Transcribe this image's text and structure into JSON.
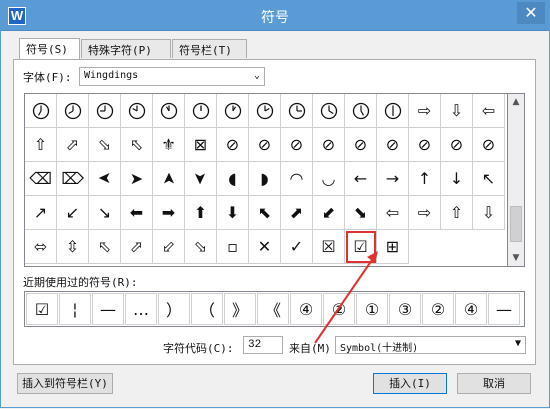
{
  "window": {
    "title": "符号",
    "app_icon": "W",
    "close_icon": "close-icon"
  },
  "tabs": [
    {
      "label": "符号(S)",
      "active": true
    },
    {
      "label": "特殊字符(P)",
      "active": false
    },
    {
      "label": "符号栏(T)",
      "active": false
    }
  ],
  "font": {
    "label": "字体(F):",
    "value": "Wingdings"
  },
  "grid": {
    "rows": [
      [
        "clock-7",
        "clock-8",
        "clock-9",
        "clock-10",
        "clock-11",
        "clock-12",
        "clock-1",
        "clock-2",
        "clock-3",
        "clock-4",
        "clock-5",
        "clock-6",
        "arrow-tab-1",
        "arrow-tab-2",
        "arrow-tab-3"
      ],
      [
        "arrow-tab-4",
        "arrow-tab-5",
        "arrow-tab-6",
        "arrow-tab-7",
        "bow-1",
        "box-x",
        "hook-1",
        "hook-2",
        "hook-3",
        "hook-4",
        "hook-5",
        "hook-6",
        "hook-7",
        "hook-8",
        "hook-9"
      ],
      [
        "backspace-1",
        "backspace-2",
        "arrowhead-left",
        "arrowhead-right",
        "arrowhead-up",
        "arrowhead-down",
        "half-circle-left",
        "half-circle-right",
        "half-circle-up",
        "half-circle-down",
        "arrow-left",
        "arrow-right",
        "arrow-up",
        "arrow-down",
        "arrow-nw"
      ],
      [
        "arrow-ne",
        "arrow-sw",
        "arrow-se",
        "bold-left",
        "bold-right",
        "bold-up",
        "bold-down",
        "bold-nw",
        "bold-ne",
        "bold-sw",
        "bold-se",
        "hollow-left",
        "hollow-right",
        "hollow-up",
        "hollow-down"
      ],
      [
        "hollow-lr",
        "hollow-ud",
        "hollow-nw",
        "hollow-ne",
        "hollow-sw",
        "hollow-se",
        "small-square",
        "x-mark",
        "check-mark",
        "boxed-x",
        "boxed-check",
        "windows-logo"
      ]
    ],
    "selected": "boxed-check"
  },
  "recent": {
    "label": "近期使用过的符号(R):",
    "items": [
      "☑",
      "¦",
      "—",
      "…",
      "）",
      "（",
      "》",
      "《",
      "④",
      "②",
      "①",
      "③",
      "②",
      "④",
      "—"
    ]
  },
  "char_code": {
    "label": "字符代码(C):",
    "value": "32"
  },
  "from": {
    "label": "来自(M)",
    "value": "Symbol(十进制)"
  },
  "buttons": {
    "insert_to_bar": "插入到符号栏(Y)",
    "insert": "插入(I)",
    "cancel": "取消"
  },
  "colors": {
    "title_bar": "#5b9bd5",
    "highlight": "#e03232"
  }
}
